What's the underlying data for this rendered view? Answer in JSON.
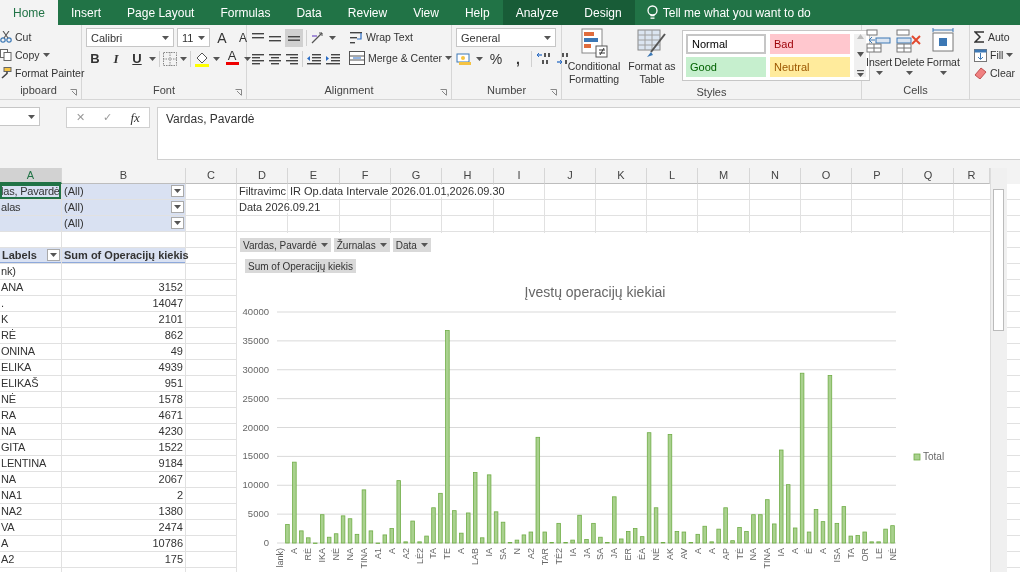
{
  "tabs": [
    {
      "label": "Home",
      "selected": true,
      "contextual": false
    },
    {
      "label": "Insert",
      "selected": false,
      "contextual": false
    },
    {
      "label": "Page Layout",
      "selected": false,
      "contextual": false
    },
    {
      "label": "Formulas",
      "selected": false,
      "contextual": false
    },
    {
      "label": "Data",
      "selected": false,
      "contextual": false
    },
    {
      "label": "Review",
      "selected": false,
      "contextual": false
    },
    {
      "label": "View",
      "selected": false,
      "contextual": false
    },
    {
      "label": "Help",
      "selected": false,
      "contextual": false
    },
    {
      "label": "Analyze",
      "selected": false,
      "contextual": true
    },
    {
      "label": "Design",
      "selected": false,
      "contextual": true
    }
  ],
  "tell_me": "Tell me what you want to do",
  "clipboard": {
    "label": "ipboard",
    "cut": "Cut",
    "copy": "Copy",
    "painter": "Format Painter"
  },
  "font": {
    "label": "Font",
    "family": "Calibri",
    "size": "11",
    "grow": "A",
    "shrink": "A",
    "bold": "B",
    "italic": "I",
    "underline": "U",
    "color_letter": "A"
  },
  "alignment": {
    "label": "Alignment",
    "wrap": "Wrap Text",
    "merge": "Merge & Center"
  },
  "number": {
    "label": "Number",
    "format": "General",
    "percent": "%",
    "comma": ","
  },
  "styles": {
    "label": "Styles",
    "conditional": "Conditional Formatting",
    "table": "Format as Table",
    "cells": [
      {
        "label": "Normal",
        "kind": "normal"
      },
      {
        "label": "Bad",
        "kind": "bad"
      },
      {
        "label": "Good",
        "kind": "good"
      },
      {
        "label": "Neutral",
        "kind": "neutral"
      }
    ]
  },
  "cells": {
    "label": "Cells",
    "buttons": [
      "Insert",
      "Delete",
      "Format"
    ]
  },
  "editing": {
    "autosum": "Auto",
    "fill": "Fill",
    "clear": "Clear"
  },
  "formula_bar": {
    "cancel": "✕",
    "enter": "✓",
    "fx": "fx",
    "value": "Vardas, Pavardė"
  },
  "sheet": {
    "columns": [
      {
        "label": "A",
        "selected": true
      },
      {
        "label": "B",
        "selected": false
      },
      {
        "label": "C",
        "selected": false
      },
      {
        "label": "D",
        "selected": false
      },
      {
        "label": "E",
        "selected": false
      },
      {
        "label": "F",
        "selected": false
      },
      {
        "label": "G",
        "selected": false
      },
      {
        "label": "H",
        "selected": false
      },
      {
        "label": "I",
        "selected": false
      },
      {
        "label": "J",
        "selected": false
      },
      {
        "label": "K",
        "selected": false
      },
      {
        "label": "L",
        "selected": false
      },
      {
        "label": "M",
        "selected": false
      },
      {
        "label": "N",
        "selected": false
      },
      {
        "label": "O",
        "selected": false
      },
      {
        "label": "P",
        "selected": false
      },
      {
        "label": "Q",
        "selected": false
      },
      {
        "label": "R",
        "selected": false
      }
    ],
    "filters": [
      {
        "label": "las, Pavardė",
        "value": "(All)",
        "selected": true
      },
      {
        "label": "alas",
        "value": "(All)",
        "selected": false
      },
      {
        "value": "(All)",
        "selected": false
      }
    ],
    "notes": [
      [
        "Filtravimc",
        "IR Op.data Intervale 2026.01.01,2026.09.30"
      ],
      [
        "Data  2026.09.21"
      ]
    ]
  },
  "pivot": {
    "header_label": "Labels",
    "header_value": "Sum of Operacijų kiekis",
    "rows": [
      {
        "label": "nk)"
      },
      {
        "label": "ANA",
        "value": "3152"
      },
      {
        "label": ".",
        "value": "14047"
      },
      {
        "label": "K",
        "value": "2101"
      },
      {
        "label": "RĖ",
        "value": "862"
      },
      {
        "label": "ONINA",
        "value": "49"
      },
      {
        "label": "ELIKA",
        "value": "4939"
      },
      {
        "label": "ELIKAŠ",
        "value": "951"
      },
      {
        "label": "NĖ",
        "value": "1578"
      },
      {
        "label": "RA",
        "value": "4671"
      },
      {
        "label": "NA",
        "value": "4230"
      },
      {
        "label": "GITA",
        "value": "1522"
      },
      {
        "label": "LENTINA",
        "value": "9184"
      },
      {
        "label": "NA",
        "value": "2067"
      },
      {
        "label": "NA1",
        "value": "2"
      },
      {
        "label": "NA2",
        "value": "1380"
      },
      {
        "label": "VA",
        "value": "2474"
      },
      {
        "label": "A",
        "value": "10786"
      },
      {
        "label": "A2",
        "value": "175"
      }
    ]
  },
  "chart": {
    "field_buttons": [
      "Vardas, Pavardė",
      "Žurnalas",
      "Data"
    ],
    "value_button": "Sum of Operacijų kiekis",
    "chart_data": {
      "type": "bar",
      "grid": true,
      "title": "Įvestų operacijų kiekiai",
      "ylim": [
        0,
        40000
      ],
      "yticks": [
        0,
        5000,
        10000,
        15000,
        20000,
        25000,
        30000,
        35000,
        40000
      ],
      "categories": [
        "lank)",
        null,
        "A",
        null,
        "RĖ",
        null,
        "IKA",
        null,
        "NĖ",
        null,
        "NA",
        null,
        "TINA",
        null,
        "A1",
        null,
        "A",
        null,
        "A2",
        null,
        "LĖ2",
        null,
        "TA",
        null,
        "TE",
        null,
        "A",
        null,
        "LAB",
        null,
        "IA",
        null,
        "SA",
        null,
        "N",
        null,
        "A2",
        null,
        "TAR",
        null,
        "TĖ2",
        null,
        "IA",
        null,
        "JA",
        null,
        "SA",
        null,
        "JA",
        null,
        "ER",
        null,
        "ĖA",
        null,
        "NĖ",
        null,
        "AK",
        null,
        "AV",
        null,
        "A",
        null,
        "A",
        null,
        "AP",
        null,
        "TĖ",
        null,
        "NA",
        null,
        "TINA",
        null,
        "IA",
        null,
        "A",
        null,
        "Ė",
        null,
        "A",
        null,
        "ISA",
        null,
        "TA",
        null,
        "OR",
        null,
        "LE",
        null,
        "NĖ"
      ],
      "series": [
        {
          "name": "Total",
          "color": "#a9d18e",
          "values": [
            null,
            3200,
            14000,
            2100,
            900,
            0,
            4900,
            1000,
            1600,
            4700,
            4200,
            1500,
            9200,
            2100,
            0,
            1400,
            2500,
            10800,
            200,
            3800,
            200,
            1200,
            6100,
            8600,
            36800,
            5600,
            1700,
            5200,
            12200,
            900,
            11800,
            5400,
            3600,
            100,
            500,
            1400,
            1900,
            18300,
            1900,
            100,
            3400,
            100,
            500,
            4800,
            600,
            3400,
            1000,
            100,
            8000,
            700,
            2000,
            2500,
            1100,
            19100,
            6100,
            100,
            18800,
            2000,
            1900,
            100,
            1500,
            2900,
            200,
            2400,
            6100,
            400,
            2700,
            2000,
            4900,
            4900,
            7500,
            3300,
            16100,
            10100,
            2600,
            29400,
            1900,
            5800,
            3700,
            29000,
            3400,
            6300,
            1200,
            1300,
            1900,
            200,
            200,
            2400,
            3000
          ]
        }
      ]
    }
  }
}
